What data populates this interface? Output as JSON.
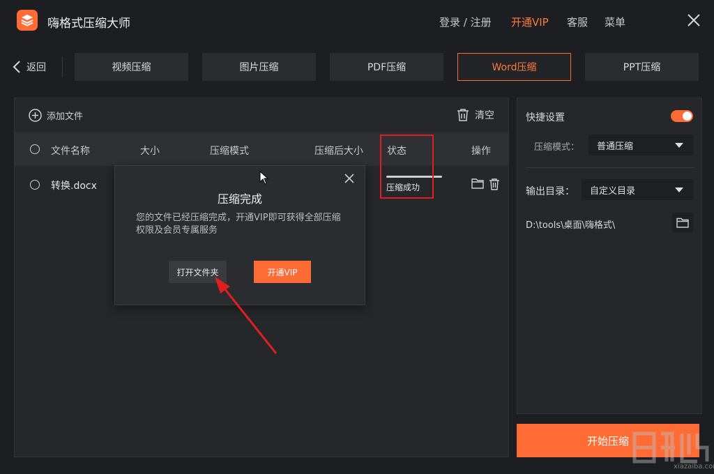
{
  "app": {
    "title": "嗨格式压缩大师"
  },
  "header": {
    "login": "登录 / 注册",
    "vip": "开通VIP",
    "service": "客服",
    "menu": "菜单"
  },
  "nav": {
    "back": "返回",
    "tabs": [
      "视频压缩",
      "图片压缩",
      "PDF压缩",
      "Word压缩",
      "PPT压缩"
    ],
    "active_tab": "Word压缩"
  },
  "file_panel": {
    "add_file": "添加文件",
    "clear": "清空",
    "columns": [
      "文件名称",
      "大小",
      "压缩模式",
      "压缩后大小",
      "状态",
      "操作"
    ],
    "rows": [
      {
        "name": "转换.docx",
        "status": "压缩成功",
        "progress": 1.0
      }
    ]
  },
  "dialog": {
    "title": "压缩完成",
    "message": "您的文件已经压缩完成，开通VIP即可获得全部压缩权限及会员专属服务",
    "open_folder": "打开文件夹",
    "vip": "开通VIP"
  },
  "settings": {
    "quick_settings": "快捷设置",
    "quick_enabled": true,
    "mode_label": "压缩模式：",
    "mode_value": "普通压缩",
    "output_label": "输出目录：",
    "output_value": "自定义目录",
    "output_path": "D:\\tools\\桌面\\嗨格式\\"
  },
  "start_button": "开始压缩",
  "watermark": "xiazaiba.com",
  "colors": {
    "accent": "#ff6b35",
    "annotation": "#e02020",
    "background": "#1d1e21",
    "panel": "#26272a"
  }
}
